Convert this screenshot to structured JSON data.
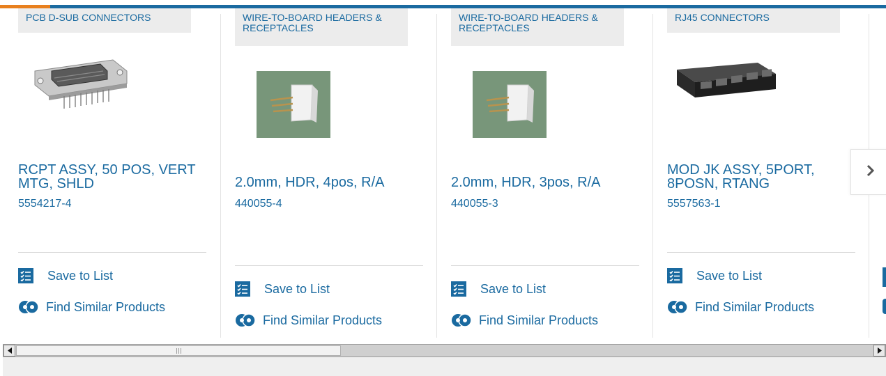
{
  "cards": [
    {
      "category": "PCB D-SUB CONNECTORS",
      "title": "RCPT ASSY, 50 POS, VERT MTG, SHLD",
      "part_number": "5554217-4",
      "save_label": "Save to List",
      "similar_label": "Find Similar Products"
    },
    {
      "category": "WIRE-TO-BOARD HEADERS & RECEPTACLES",
      "title": "2.0mm, HDR, 4pos, R/A",
      "part_number": "440055-4",
      "save_label": "Save to List",
      "similar_label": "Find Similar Products"
    },
    {
      "category": "WIRE-TO-BOARD HEADERS & RECEPTACLES",
      "title": "2.0mm, HDR, 3pos, R/A",
      "part_number": "440055-3",
      "save_label": "Save to List",
      "similar_label": "Find Similar Products"
    },
    {
      "category": "RJ45 CONNECTORS",
      "title": "MOD JK ASSY, 5PORT, 8POSN, RTANG",
      "part_number": "5557563-1",
      "save_label": "Save to List",
      "similar_label": "Find Similar Products"
    }
  ],
  "icons": {
    "next": "chevron-right-icon",
    "save": "list-icon",
    "similar": "gear-icon",
    "scroll_left": "arrow-left-icon",
    "scroll_right": "arrow-right-icon"
  },
  "colors": {
    "accent": "#1a6aa0",
    "highlight": "#e8801e",
    "category_bg": "#ececec"
  }
}
